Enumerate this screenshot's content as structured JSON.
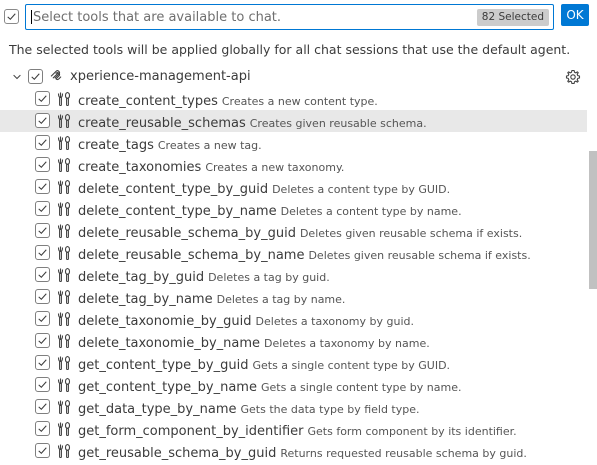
{
  "search": {
    "placeholder": "Select tools that are available to chat.",
    "value": "",
    "selected_badge": "82 Selected",
    "select_all_checked": true
  },
  "ok_label": "OK",
  "description": "The selected tools will be applied globally for all chat sessions that use the default agent.",
  "group": {
    "label": "xperience-management-api",
    "expanded": true,
    "checked": true
  },
  "tools": [
    {
      "name": "create_content_types",
      "desc": "Creates a new content type."
    },
    {
      "name": "create_reusable_schemas",
      "desc": "Creates given reusable schema."
    },
    {
      "name": "create_tags",
      "desc": "Creates a new tag."
    },
    {
      "name": "create_taxonomies",
      "desc": "Creates a new taxonomy."
    },
    {
      "name": "delete_content_type_by_guid",
      "desc": "Deletes a content type by GUID."
    },
    {
      "name": "delete_content_type_by_name",
      "desc": "Deletes a content type by name."
    },
    {
      "name": "delete_reusable_schema_by_guid",
      "desc": "Deletes given reusable schema if exists."
    },
    {
      "name": "delete_reusable_schema_by_name",
      "desc": "Deletes given reusable schema if exists."
    },
    {
      "name": "delete_tag_by_guid",
      "desc": "Deletes a tag by guid."
    },
    {
      "name": "delete_tag_by_name",
      "desc": "Deletes a tag by name."
    },
    {
      "name": "delete_taxonomie_by_guid",
      "desc": "Deletes a taxonomy by guid."
    },
    {
      "name": "delete_taxonomie_by_name",
      "desc": "Deletes a taxonomy by name."
    },
    {
      "name": "get_content_type_by_guid",
      "desc": "Gets a single content type by GUID."
    },
    {
      "name": "get_content_type_by_name",
      "desc": "Gets a single content type by name."
    },
    {
      "name": "get_data_type_by_name",
      "desc": "Gets the data type by field type."
    },
    {
      "name": "get_form_component_by_identifier",
      "desc": "Gets form component by its identifier."
    },
    {
      "name": "get_reusable_schema_by_guid",
      "desc": "Returns requested reusable schema by guid."
    }
  ],
  "hovered_index": 1,
  "colors": {
    "accent": "#0078d4",
    "hover_row": "#e8e8e8",
    "badge_bg": "#cccccc"
  },
  "icons": {
    "select_all": "check-icon",
    "group_chevron": "chevron-down-icon",
    "group_icon": "mcp-server-icon",
    "settings": "gear-icon",
    "tool": "tool-icon"
  }
}
